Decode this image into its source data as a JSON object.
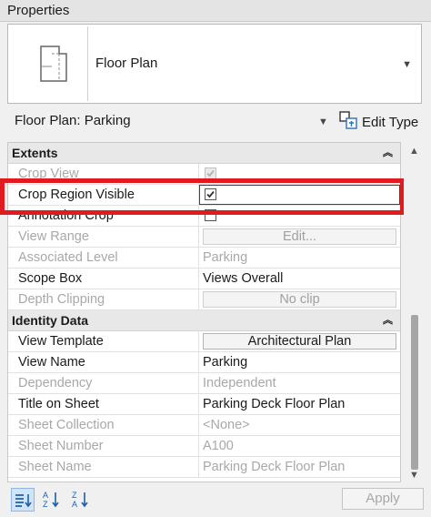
{
  "panel": {
    "title": "Properties"
  },
  "type_selector": {
    "icon": "floor-plan-icon",
    "name": "Floor Plan"
  },
  "view_instance": {
    "label": "Floor Plan: Parking",
    "edit_type_label": "Edit Type",
    "edit_type_icon": "edit-type-icon"
  },
  "categories": {
    "extents": "Extents",
    "identity": "Identity Data"
  },
  "extents_rows": [
    {
      "name": "Crop View",
      "value": "",
      "kind": "checkbox",
      "checked": true,
      "disabled": true
    },
    {
      "name": "Crop Region Visible",
      "value": "",
      "kind": "checkbox",
      "checked": true,
      "disabled": false
    },
    {
      "name": "Annotation Crop",
      "value": "",
      "kind": "checkbox",
      "checked": false,
      "disabled": false
    },
    {
      "name": "View Range",
      "value": "Edit...",
      "kind": "button",
      "disabled": true
    },
    {
      "name": "Associated Level",
      "value": "Parking",
      "kind": "text",
      "disabled": true
    },
    {
      "name": "Scope Box",
      "value": "Views Overall",
      "kind": "text",
      "disabled": false
    },
    {
      "name": "Depth Clipping",
      "value": "No clip",
      "kind": "button",
      "disabled": true
    }
  ],
  "identity_rows": [
    {
      "name": "View Template",
      "value": "Architectural Plan",
      "kind": "button",
      "disabled": false
    },
    {
      "name": "View Name",
      "value": "Parking",
      "kind": "text",
      "disabled": false
    },
    {
      "name": "Dependency",
      "value": "Independent",
      "kind": "text",
      "disabled": true
    },
    {
      "name": "Title on Sheet",
      "value": "Parking Deck Floor Plan",
      "kind": "text",
      "disabled": false
    },
    {
      "name": "Sheet Collection",
      "value": "<None>",
      "kind": "text",
      "disabled": true
    },
    {
      "name": "Sheet Number",
      "value": "A100",
      "kind": "text",
      "disabled": true
    },
    {
      "name": "Sheet Name",
      "value": "Parking Deck Floor Plan",
      "kind": "text",
      "disabled": true
    }
  ],
  "footer": {
    "apply_label": "Apply"
  },
  "colors": {
    "highlight": "#e01a1f",
    "active_tool": "#cfe4f8"
  }
}
